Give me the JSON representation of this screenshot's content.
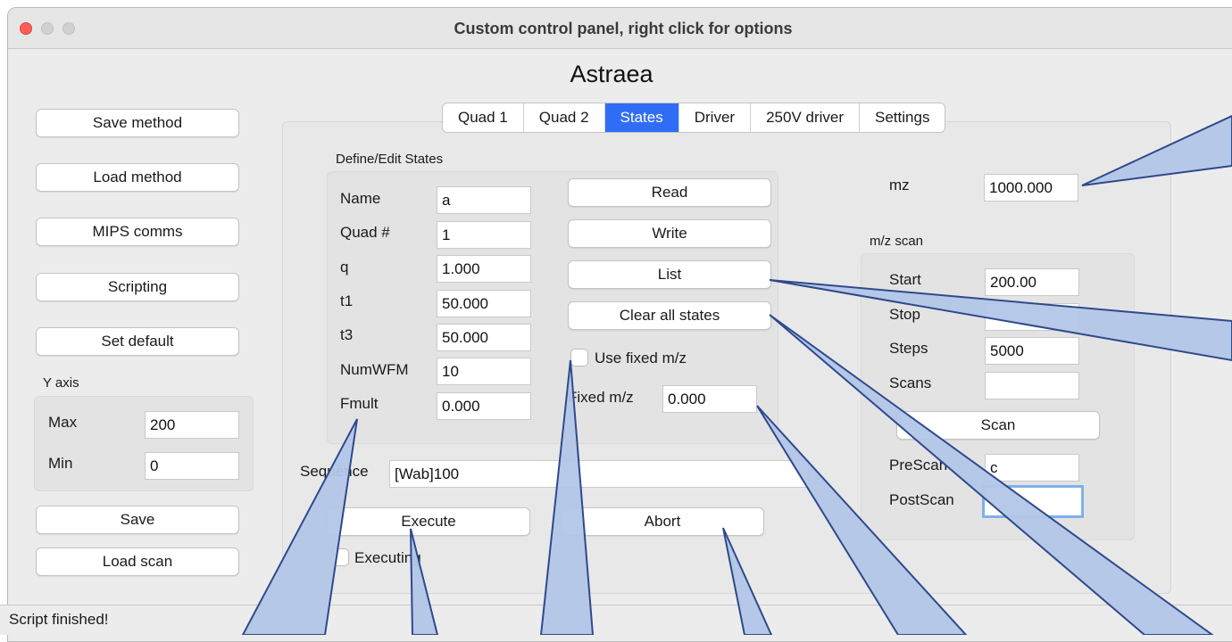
{
  "window": {
    "title": "Custom control panel, right click for options"
  },
  "app_title": "Astraea",
  "left_buttons": {
    "save_method": "Save method",
    "load_method": "Load method",
    "mips_comms": "MIPS comms",
    "scripting": "Scripting",
    "set_default": "Set default",
    "save": "Save",
    "load_scan": "Load scan"
  },
  "y_axis": {
    "title": "Y axis",
    "max_label": "Max",
    "max_value": "200",
    "min_label": "Min",
    "min_value": "0"
  },
  "tabs": [
    {
      "label": "Quad 1"
    },
    {
      "label": "Quad 2"
    },
    {
      "label": "States"
    },
    {
      "label": "Driver"
    },
    {
      "label": "250V driver"
    },
    {
      "label": "Settings"
    }
  ],
  "states": {
    "group_title": "Define/Edit States",
    "fields": [
      {
        "label": "Name",
        "value": "a"
      },
      {
        "label": "Quad #",
        "value": "1"
      },
      {
        "label": "q",
        "value": "1.000"
      },
      {
        "label": "t1",
        "value": "50.000"
      },
      {
        "label": "t3",
        "value": "50.000"
      },
      {
        "label": "NumWFM",
        "value": "10"
      },
      {
        "label": "Fmult",
        "value": "0.000"
      }
    ],
    "read": "Read",
    "write": "Write",
    "list": "List",
    "clear_all": "Clear all states",
    "use_fixed_mz": "Use fixed m/z",
    "fixed_mz_label": "Fixed m/z",
    "fixed_mz_value": "0.000",
    "sequence_label": "Sequence",
    "sequence_value": "[Wab]100",
    "execute": "Execute",
    "abort": "Abort",
    "executing": "Executing"
  },
  "mz": {
    "label": "mz",
    "value": "1000.000"
  },
  "mz_scan": {
    "title": "m/z scan",
    "start_label": "Start",
    "start_value": "200.00",
    "stop_label": "Stop",
    "steps_label": "Steps",
    "steps_value": "5000",
    "scans_label": "Scans",
    "scans_value": "",
    "scan_button": "Scan",
    "prescan_label": "PreScan",
    "prescan_value": "c",
    "postscan_label": "PostScan",
    "postscan_value": ""
  },
  "status": {
    "text": "Script finished!"
  },
  "colors": {
    "active_tab": "#2f6df6",
    "callout_fill": "#b3c6e7",
    "callout_stroke": "#2e4a8c"
  }
}
